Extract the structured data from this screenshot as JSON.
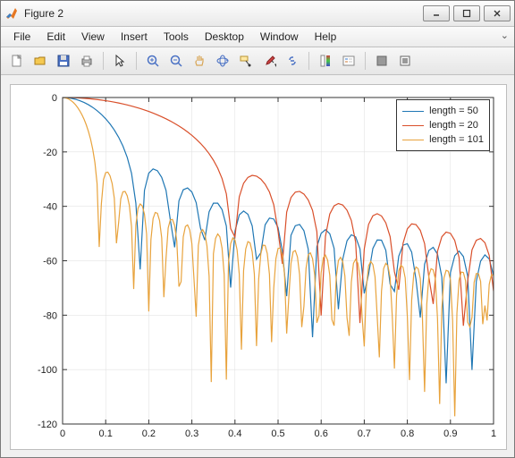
{
  "window": {
    "title": "Figure 2",
    "buttons": {
      "minimize": "–",
      "maximize": "□",
      "close": "✕"
    }
  },
  "menu": {
    "items": [
      "File",
      "Edit",
      "View",
      "Insert",
      "Tools",
      "Desktop",
      "Window",
      "Help"
    ],
    "right": "⌄"
  },
  "toolbar": {
    "icons": [
      "new-file-icon",
      "open-file-icon",
      "save-icon",
      "print-icon",
      "pointer-icon",
      "zoom-in-icon",
      "zoom-out-icon",
      "pan-icon",
      "rotate3d-icon",
      "data-cursor-icon",
      "brush-icon",
      "link-icon",
      "colorbar-icon",
      "legend-icon",
      "hide-plot-icon",
      "show-plot-icon"
    ]
  },
  "chart_data": {
    "type": "line",
    "xlim": [
      0,
      1
    ],
    "ylim": [
      -120,
      0
    ],
    "xticks": [
      0,
      0.1,
      0.2,
      0.3,
      0.4,
      0.5,
      0.6,
      0.7,
      0.8,
      0.9,
      1
    ],
    "yticks": [
      0,
      -20,
      -40,
      -60,
      -80,
      -100,
      -120
    ],
    "xlabel": "",
    "ylabel": "",
    "title": "",
    "legend_position": "northeast",
    "grid": true,
    "series": [
      {
        "name": "length = 50",
        "color": "#1f77b4",
        "x": [
          0.0,
          0.01,
          0.02,
          0.03,
          0.04,
          0.05,
          0.06,
          0.07,
          0.08,
          0.09,
          0.1,
          0.11,
          0.12,
          0.13,
          0.14,
          0.15,
          0.16,
          0.17,
          0.18,
          0.19,
          0.2,
          0.21,
          0.22,
          0.23,
          0.24,
          0.25,
          0.26,
          0.27,
          0.28,
          0.29,
          0.3,
          0.31,
          0.32,
          0.33,
          0.34,
          0.35,
          0.36,
          0.37,
          0.38,
          0.39,
          0.4,
          0.41,
          0.42,
          0.43,
          0.44,
          0.45,
          0.46,
          0.47,
          0.48,
          0.49,
          0.5,
          0.51,
          0.52,
          0.53,
          0.54,
          0.55,
          0.56,
          0.57,
          0.58,
          0.59,
          0.6,
          0.61,
          0.62,
          0.63,
          0.64,
          0.65,
          0.66,
          0.67,
          0.68,
          0.69,
          0.7,
          0.71,
          0.72,
          0.73,
          0.74,
          0.75,
          0.76,
          0.77,
          0.78,
          0.79,
          0.8,
          0.81,
          0.82,
          0.83,
          0.84,
          0.85,
          0.86,
          0.87,
          0.88,
          0.89,
          0.9,
          0.91,
          0.92,
          0.93,
          0.94,
          0.95,
          0.96,
          0.97,
          0.98,
          0.99,
          1.0
        ],
        "y": [
          0.0,
          -0.07,
          -0.29,
          -0.65,
          -1.16,
          -1.82,
          -2.65,
          -3.64,
          -4.82,
          -6.21,
          -7.82,
          -9.71,
          -11.94,
          -14.59,
          -17.84,
          -22.0,
          -27.86,
          -38.83,
          -63.19,
          -34.12,
          -27.8,
          -26.24,
          -26.91,
          -29.35,
          -34.11,
          -44.98,
          -55.07,
          -37.96,
          -33.91,
          -33.24,
          -34.73,
          -38.65,
          -48.0,
          -52.41,
          -41.99,
          -38.81,
          -38.83,
          -41.18,
          -47.24,
          -69.85,
          -49.12,
          -43.12,
          -41.72,
          -42.89,
          -47.17,
          -59.43,
          -57.05,
          -46.77,
          -44.31,
          -44.66,
          -47.81,
          -56.43,
          -73.03,
          -50.65,
          -47.13,
          -46.65,
          -48.96,
          -55.71,
          -88.12,
          -54.83,
          -49.91,
          -48.57,
          -50.06,
          -55.42,
          -77.84,
          -59.48,
          -52.66,
          -50.47,
          -51.21,
          -55.62,
          -72.01,
          -64.99,
          -55.46,
          -52.36,
          -52.44,
          -56.15,
          -68.59,
          -71.26,
          -58.33,
          -54.27,
          -53.74,
          -56.82,
          -66.85,
          -80.87,
          -61.28,
          -56.2,
          -55.08,
          -57.58,
          -66.01,
          -105.04,
          -64.34,
          -58.15,
          -56.44,
          -58.42,
          -65.59,
          -100.13,
          -67.53,
          -60.13,
          -57.84,
          -59.32,
          -65.42
        ]
      },
      {
        "name": "length = 20",
        "color": "#d94f2a",
        "x": [
          0.0,
          0.01,
          0.02,
          0.03,
          0.04,
          0.05,
          0.06,
          0.07,
          0.08,
          0.09,
          0.1,
          0.11,
          0.12,
          0.13,
          0.14,
          0.15,
          0.16,
          0.17,
          0.18,
          0.19,
          0.2,
          0.21,
          0.22,
          0.23,
          0.24,
          0.25,
          0.26,
          0.27,
          0.28,
          0.29,
          0.3,
          0.31,
          0.32,
          0.33,
          0.34,
          0.35,
          0.36,
          0.37,
          0.38,
          0.39,
          0.4,
          0.41,
          0.42,
          0.43,
          0.44,
          0.45,
          0.46,
          0.47,
          0.48,
          0.49,
          0.5,
          0.51,
          0.52,
          0.53,
          0.54,
          0.55,
          0.56,
          0.57,
          0.58,
          0.59,
          0.6,
          0.61,
          0.62,
          0.63,
          0.64,
          0.65,
          0.66,
          0.67,
          0.68,
          0.69,
          0.7,
          0.71,
          0.72,
          0.73,
          0.74,
          0.75,
          0.76,
          0.77,
          0.78,
          0.79,
          0.8,
          0.81,
          0.82,
          0.83,
          0.84,
          0.85,
          0.86,
          0.87,
          0.88,
          0.89,
          0.9,
          0.91,
          0.92,
          0.93,
          0.94,
          0.95,
          0.96,
          0.97,
          0.98,
          0.99,
          1.0
        ],
        "y": [
          0.0,
          -0.01,
          -0.05,
          -0.1,
          -0.18,
          -0.29,
          -0.42,
          -0.57,
          -0.74,
          -0.94,
          -1.17,
          -1.42,
          -1.71,
          -2.02,
          -2.36,
          -2.74,
          -3.14,
          -3.58,
          -4.06,
          -4.58,
          -5.13,
          -5.73,
          -6.38,
          -7.08,
          -7.83,
          -8.64,
          -9.52,
          -10.48,
          -11.52,
          -12.66,
          -13.92,
          -15.31,
          -16.86,
          -18.62,
          -20.65,
          -23.05,
          -25.97,
          -29.78,
          -35.42,
          -48.17,
          -51.3,
          -36.49,
          -31.52,
          -29.37,
          -28.62,
          -28.91,
          -30.0,
          -31.87,
          -34.73,
          -39.42,
          -49.17,
          -61.15,
          -42.11,
          -36.74,
          -34.78,
          -34.51,
          -35.49,
          -37.64,
          -41.47,
          -49.27,
          -80.14,
          -51.0,
          -42.82,
          -39.82,
          -38.96,
          -39.5,
          -41.43,
          -45.18,
          -53.12,
          -82.88,
          -55.69,
          -46.65,
          -43.48,
          -42.7,
          -43.53,
          -46.06,
          -51.14,
          -64.03,
          -70.65,
          -53.58,
          -48.26,
          -46.45,
          -46.69,
          -48.81,
          -53.71,
          -66.12,
          -75.87,
          -56.5,
          -51.18,
          -49.45,
          -49.92,
          -52.55,
          -58.81,
          -83.91,
          -67.42,
          -55.97,
          -52.46,
          -51.8,
          -53.35,
          -58.06,
          -71.13
        ]
      },
      {
        "name": "length = 101",
        "color": "#e8a33d",
        "x": [
          0.0,
          0.005,
          0.01,
          0.015,
          0.02,
          0.025,
          0.03,
          0.035,
          0.04,
          0.045,
          0.05,
          0.055,
          0.06,
          0.065,
          0.07,
          0.075,
          0.08,
          0.085,
          0.09,
          0.095,
          0.1,
          0.105,
          0.11,
          0.115,
          0.12,
          0.125,
          0.13,
          0.135,
          0.14,
          0.145,
          0.15,
          0.155,
          0.16,
          0.165,
          0.17,
          0.175,
          0.18,
          0.185,
          0.19,
          0.195,
          0.2,
          0.205,
          0.21,
          0.215,
          0.22,
          0.225,
          0.23,
          0.235,
          0.24,
          0.245,
          0.25,
          0.255,
          0.26,
          0.265,
          0.27,
          0.275,
          0.28,
          0.285,
          0.29,
          0.295,
          0.3,
          0.305,
          0.31,
          0.315,
          0.32,
          0.325,
          0.33,
          0.335,
          0.34,
          0.345,
          0.35,
          0.355,
          0.36,
          0.365,
          0.37,
          0.375,
          0.38,
          0.385,
          0.39,
          0.395,
          0.4,
          0.405,
          0.41,
          0.415,
          0.42,
          0.425,
          0.43,
          0.435,
          0.44,
          0.445,
          0.45,
          0.455,
          0.46,
          0.465,
          0.47,
          0.475,
          0.48,
          0.485,
          0.49,
          0.495,
          0.5,
          0.505,
          0.51,
          0.515,
          0.52,
          0.525,
          0.53,
          0.535,
          0.54,
          0.545,
          0.55,
          0.555,
          0.56,
          0.565,
          0.57,
          0.575,
          0.58,
          0.585,
          0.59,
          0.595,
          0.6,
          0.605,
          0.61,
          0.615,
          0.62,
          0.625,
          0.63,
          0.635,
          0.64,
          0.645,
          0.65,
          0.655,
          0.66,
          0.665,
          0.67,
          0.675,
          0.68,
          0.685,
          0.69,
          0.695,
          0.7,
          0.705,
          0.71,
          0.715,
          0.72,
          0.725,
          0.73,
          0.735,
          0.74,
          0.745,
          0.75,
          0.755,
          0.76,
          0.765,
          0.77,
          0.775,
          0.78,
          0.785,
          0.79,
          0.795,
          0.8,
          0.805,
          0.81,
          0.815,
          0.82,
          0.825,
          0.83,
          0.835,
          0.84,
          0.845,
          0.85,
          0.855,
          0.86,
          0.865,
          0.87,
          0.875,
          0.88,
          0.885,
          0.89,
          0.895,
          0.9,
          0.905,
          0.91,
          0.915,
          0.92,
          0.925,
          0.93,
          0.935,
          0.94,
          0.945,
          0.95,
          0.955,
          0.96,
          0.965,
          0.97,
          0.975,
          0.98,
          0.985,
          0.99,
          0.995,
          1.0
        ],
        "y": [
          0.0,
          -0.07,
          -0.29,
          -0.65,
          -1.17,
          -1.84,
          -2.68,
          -3.71,
          -4.93,
          -6.37,
          -8.07,
          -10.07,
          -12.47,
          -15.37,
          -19.02,
          -23.92,
          -31.58,
          -54.92,
          -39.07,
          -30.13,
          -27.63,
          -27.43,
          -28.75,
          -31.61,
          -37.0,
          -53.56,
          -46.05,
          -37.22,
          -34.66,
          -34.54,
          -36.12,
          -39.71,
          -47.48,
          -70.4,
          -46.87,
          -40.71,
          -39.12,
          -39.85,
          -42.91,
          -50.13,
          -78.63,
          -52.21,
          -44.48,
          -42.24,
          -42.55,
          -45.2,
          -51.61,
          -73.4,
          -59.16,
          -47.97,
          -44.95,
          -44.82,
          -47.04,
          -52.77,
          -69.49,
          -67.69,
          -51.23,
          -47.41,
          -46.81,
          -48.63,
          -53.74,
          -66.95,
          -80.58,
          -54.37,
          -49.66,
          -48.55,
          -49.99,
          -54.59,
          -65.7,
          -104.58,
          -57.44,
          -51.76,
          -50.14,
          -51.22,
          -55.36,
          -65.16,
          -103.68,
          -60.51,
          -53.73,
          -51.61,
          -52.34,
          -56.07,
          -64.97,
          -92.65,
          -63.6,
          -55.62,
          -52.98,
          -53.4,
          -56.74,
          -64.97,
          -91.35,
          -66.75,
          -57.44,
          -54.27,
          -54.39,
          -57.37,
          -64.99,
          -89.9,
          -69.97,
          -59.22,
          -55.49,
          -55.34,
          -58.0,
          -65.04,
          -86.73,
          -73.28,
          -60.97,
          -56.66,
          -56.24,
          -58.6,
          -65.12,
          -84.39,
          -76.69,
          -62.7,
          -57.78,
          -57.1,
          -59.18,
          -65.23,
          -82.78,
          -80.21,
          -64.41,
          -58.86,
          -57.93,
          -59.75,
          -65.37,
          -81.68,
          -83.85,
          -66.11,
          -59.9,
          -58.73,
          -60.31,
          -65.53,
          -80.96,
          -87.61,
          -67.81,
          -60.91,
          -59.49,
          -60.85,
          -65.7,
          -80.54,
          -91.49,
          -69.5,
          -61.88,
          -60.23,
          -61.38,
          -65.89,
          -80.37,
          -95.5,
          -71.17,
          -62.83,
          -60.94,
          -61.89,
          -66.09,
          -80.39,
          -99.62,
          -72.83,
          -63.74,
          -61.63,
          -62.4,
          -66.3,
          -80.56,
          -103.86,
          -74.48,
          -64.63,
          -62.28,
          -62.89,
          -66.53,
          -80.89,
          -108.19,
          -76.11,
          -65.49,
          -62.92,
          -63.38,
          -66.78,
          -81.34,
          -112.63,
          -77.72,
          -66.33,
          -63.53,
          -63.85,
          -67.03,
          -81.9,
          -117.15,
          -79.31,
          -67.15,
          -64.13,
          -64.32,
          -67.31,
          -82.56,
          -84.34,
          -80.8,
          -67.94,
          -64.7,
          -64.77,
          -67.61,
          -83.31,
          -76.46,
          -81.96,
          -68.67,
          -65.25,
          -65.23
        ]
      }
    ]
  }
}
